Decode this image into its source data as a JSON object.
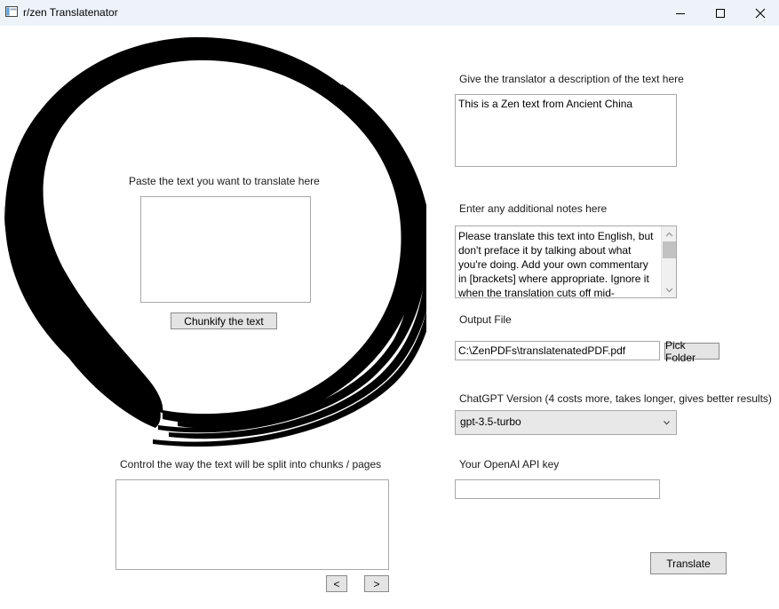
{
  "window": {
    "title": "r/zen Translatenator",
    "icon": "app-window-icon",
    "controls": [
      "minimize-icon",
      "maximize-icon",
      "close-icon"
    ]
  },
  "source": {
    "label": "Paste the text you want to translate here",
    "value": "",
    "chunkify_label": "Chunkify the text"
  },
  "chunks": {
    "label": "Control the way the text will be split into chunks / pages",
    "value": "",
    "prev_label": "<",
    "next_label": ">"
  },
  "description": {
    "label": "Give the translator a description of the text here",
    "value": "This is a Zen text from Ancient China"
  },
  "notes": {
    "label": "Enter any additional notes here",
    "value": "Please translate this text into English, but don't preface it by talking about what you're doing. Add your own commentary in [brackets] where appropriate. Ignore it when the translation cuts off mid-"
  },
  "output": {
    "label": "Output File",
    "value": "C:\\ZenPDFs\\translatenatedPDF.pdf",
    "pick_label": "Pick Folder"
  },
  "model": {
    "label": "ChatGPT Version (4 costs more, takes longer, gives better results)",
    "selected": "gpt-3.5-turbo"
  },
  "api_key": {
    "label": "Your OpenAI API key",
    "value": ""
  },
  "translate_label": "Translate",
  "decoration": {
    "image": "enso-circle-brush-stroke",
    "color": "#000000"
  }
}
